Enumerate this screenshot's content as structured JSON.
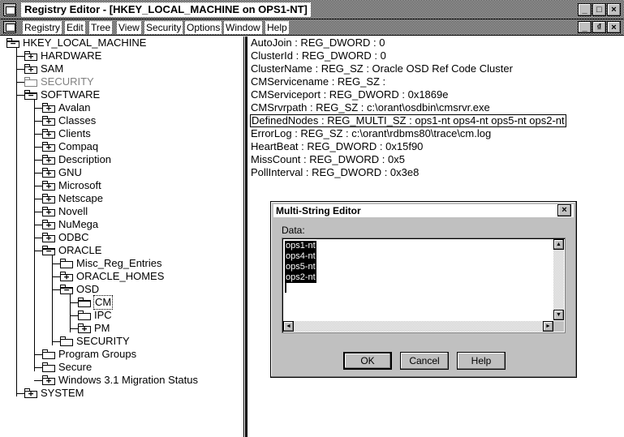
{
  "window": {
    "title": "Registry Editor - [HKEY_LOCAL_MACHINE on OPS1-NT]",
    "controls": {
      "minimize": "_",
      "maximize": "□",
      "close": "×",
      "restore": "₫"
    }
  },
  "menu": [
    "Registry",
    "Edit",
    "Tree",
    "View",
    "Security",
    "Options",
    "Window",
    "Help"
  ],
  "tree": [
    {
      "label": "HKEY_LOCAL_MACHINE",
      "sign": "−",
      "level": 0,
      "open": true
    },
    {
      "label": "HARDWARE",
      "sign": "+",
      "level": 1
    },
    {
      "label": "SAM",
      "sign": "+",
      "level": 1
    },
    {
      "label": "SECURITY",
      "sign": "",
      "level": 1,
      "dimmed": true
    },
    {
      "label": "SOFTWARE",
      "sign": "−",
      "level": 1,
      "open": true
    },
    {
      "label": "Avalan",
      "sign": "+",
      "level": 2
    },
    {
      "label": "Classes",
      "sign": "+",
      "level": 2
    },
    {
      "label": "Clients",
      "sign": "+",
      "level": 2
    },
    {
      "label": "Compaq",
      "sign": "+",
      "level": 2
    },
    {
      "label": "Description",
      "sign": "+",
      "level": 2
    },
    {
      "label": "GNU",
      "sign": "+",
      "level": 2
    },
    {
      "label": "Microsoft",
      "sign": "+",
      "level": 2
    },
    {
      "label": "Netscape",
      "sign": "+",
      "level": 2
    },
    {
      "label": "Novell",
      "sign": "+",
      "level": 2
    },
    {
      "label": "NuMega",
      "sign": "+",
      "level": 2
    },
    {
      "label": "ODBC",
      "sign": "+",
      "level": 2
    },
    {
      "label": "ORACLE",
      "sign": "−",
      "level": 2,
      "open": true
    },
    {
      "label": "Misc_Reg_Entries",
      "sign": "",
      "level": 3
    },
    {
      "label": "ORACLE_HOMES",
      "sign": "+",
      "level": 3
    },
    {
      "label": "OSD",
      "sign": "−",
      "level": 3,
      "open": true
    },
    {
      "label": "CM",
      "sign": "",
      "level": 4,
      "selected": true,
      "open": true
    },
    {
      "label": "IPC",
      "sign": "",
      "level": 4
    },
    {
      "label": "PM",
      "sign": "+",
      "level": 4
    },
    {
      "label": "SECURITY",
      "sign": "",
      "level": 3
    },
    {
      "label": "Program Groups",
      "sign": "",
      "level": 2
    },
    {
      "label": "Secure",
      "sign": "",
      "level": 2
    },
    {
      "label": "Windows 3.1 Migration Status",
      "sign": "+",
      "level": 2
    },
    {
      "label": "SYSTEM",
      "sign": "+",
      "level": 1
    }
  ],
  "values": [
    "AutoJoin : REG_DWORD : 0",
    "ClusterId : REG_DWORD : 0",
    "ClusterName : REG_SZ : Oracle OSD Ref Code Cluster",
    "CMServicename : REG_SZ :",
    "CMServiceport : REG_DWORD : 0x1869e",
    "CMSrvrpath : REG_SZ : c:\\orant\\osdbin\\cmsrvr.exe",
    "DefinedNodes : REG_MULTI_SZ : ops1-nt ops4-nt ops5-nt ops2-nt",
    "ErrorLog : REG_SZ : c:\\orant\\rdbms80\\trace\\cm.log",
    "HeartBeat : REG_DWORD : 0x15f90",
    "MissCount : REG_DWORD : 0x5",
    "PollInterval : REG_DWORD : 0x3e8"
  ],
  "focused_value_index": 6,
  "dialog": {
    "title": "Multi-String Editor",
    "close": "×",
    "data_label": "Data:",
    "data_lines": [
      "ops1-nt",
      "ops4-nt",
      "ops5-nt",
      "ops2-nt"
    ],
    "buttons": {
      "ok": "OK",
      "cancel": "Cancel",
      "help": "Help"
    },
    "scroll_up": "▲",
    "scroll_down": "▼",
    "scroll_left": "◄",
    "scroll_right": "►"
  }
}
